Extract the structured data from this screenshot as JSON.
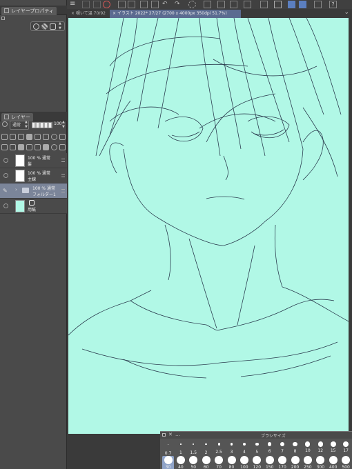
{
  "layer_property": {
    "tab_label": "レイヤープロパティ"
  },
  "layer_panel": {
    "tab_label": "レイヤー",
    "blend_mode": "通常",
    "opacity": "100",
    "layers": [
      {
        "line1": "100 % 通常",
        "line2": "髪"
      },
      {
        "line1": "100 % 通常",
        "line2": "主線"
      },
      {
        "line1": "100 % 通常",
        "line2": "フォルダー1"
      },
      {
        "line1": "",
        "line2": "用紙"
      }
    ]
  },
  "tabs": {
    "tab1": "覗いて温 70/92",
    "tab2": "イラスト 2022* 27/27 (2700 x 4000px 350dpi 51.7%)"
  },
  "brush_size": {
    "title": "ブラシサイズ",
    "row1": [
      "0.7",
      "1",
      "1.5",
      "2",
      "2.5",
      "3",
      "4",
      "5",
      "6",
      "7",
      "8",
      "10",
      "12",
      "15",
      "17"
    ],
    "row2": [
      "30",
      "40",
      "50",
      "60",
      "70",
      "80",
      "100",
      "120",
      "150",
      "170",
      "200",
      "250",
      "300",
      "400",
      "500"
    ]
  },
  "colors": {
    "canvas": "#b1f8e6",
    "selection": "#7b8599",
    "accent": "#5b7fc0"
  }
}
